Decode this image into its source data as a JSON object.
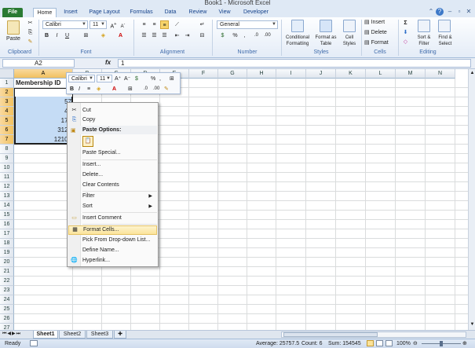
{
  "window": {
    "title": "Book1 - Microsoft Excel"
  },
  "tabs": [
    "File",
    "Home",
    "Insert",
    "Page Layout",
    "Formulas",
    "Data",
    "Review",
    "View",
    "Developer"
  ],
  "ribbon": {
    "clipboard": {
      "label": "Clipboard",
      "paste": "Paste"
    },
    "font": {
      "label": "Font",
      "name": "Calibri",
      "size": "11"
    },
    "alignment": {
      "label": "Alignment"
    },
    "number": {
      "label": "Number",
      "format": "General"
    },
    "styles": {
      "label": "Styles",
      "conditional": "Conditional Formatting",
      "format_table": "Format as Table",
      "cell_styles": "Cell Styles"
    },
    "cells": {
      "label": "Cells",
      "insert": "Insert",
      "delete": "Delete",
      "format": "Format"
    },
    "editing": {
      "label": "Editing",
      "sort": "Sort & Filter",
      "find": "Find & Select"
    }
  },
  "formula_bar": {
    "name_box": "A2",
    "fx": "fx",
    "value": "1"
  },
  "columns": [
    "A",
    "B",
    "C",
    "D",
    "E",
    "F",
    "G",
    "H",
    "I",
    "J",
    "K",
    "L",
    "M",
    "N"
  ],
  "rows": [
    "1",
    "2",
    "3",
    "4",
    "5",
    "6",
    "7",
    "8",
    "9",
    "10",
    "11",
    "12",
    "13",
    "14",
    "15",
    "16",
    "17",
    "18",
    "19",
    "20",
    "21",
    "22",
    "23",
    "24",
    "25",
    "26",
    "27"
  ],
  "cells": {
    "A1": "Membership ID",
    "A3": "57",
    "A4": "48",
    "A5": "175",
    "A6": "3120",
    "A7": "12105"
  },
  "mini_toolbar": {
    "font": "Calibri",
    "size": "11"
  },
  "context_menu": {
    "cut": "Cut",
    "copy": "Copy",
    "paste_options": "Paste Options:",
    "paste_special": "Paste Special...",
    "insert": "Insert...",
    "delete": "Delete...",
    "clear_contents": "Clear Contents",
    "filter": "Filter",
    "sort": "Sort",
    "insert_comment": "Insert Comment",
    "format_cells": "Format Cells...",
    "pick_list": "Pick From Drop-down List...",
    "define_name": "Define Name...",
    "hyperlink": "Hyperlink..."
  },
  "sheets": [
    "Sheet1",
    "Sheet2",
    "Sheet3"
  ],
  "status": {
    "ready": "Ready",
    "average": "Average: 25757.5",
    "count": "Count: 6",
    "sum": "Sum: 154545",
    "zoom": "100%"
  },
  "colors": {
    "selection": "#c5dcf5",
    "file_tab": "#2a7a33",
    "highlight": "#fbe39a"
  }
}
